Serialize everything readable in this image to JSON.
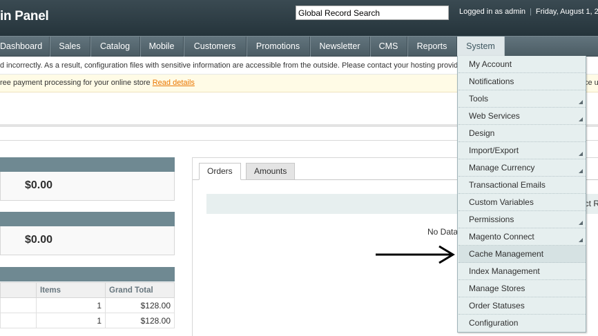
{
  "header": {
    "logo_text": "in Panel",
    "search_value": "Global Record Search",
    "user_text": "Logged in as admin",
    "date_text": "Friday, August 1, 2"
  },
  "nav": {
    "items": [
      {
        "label": "Dashboard"
      },
      {
        "label": "Sales"
      },
      {
        "label": "Catalog"
      },
      {
        "label": "Mobile"
      },
      {
        "label": "Customers"
      },
      {
        "label": "Promotions"
      },
      {
        "label": "Newsletter"
      },
      {
        "label": "CMS"
      },
      {
        "label": "Reports"
      },
      {
        "label": "System"
      }
    ]
  },
  "notices": {
    "warning_text": "d incorrectly. As a result, configuration files with sensitive information are accessible from the outside. Please contact your hosting provid",
    "promo_text": "ree payment processing for your online store ",
    "promo_link": "Read details",
    "promo_tail": "ce u"
  },
  "dashboard": {
    "box1_amount": "$0.00",
    "box2_amount": "$0.00",
    "orders_table": {
      "headers": [
        "",
        "Items",
        "Grand Total"
      ],
      "rows": [
        [
          "",
          "1",
          "$128.00"
        ],
        [
          "",
          "1",
          "$128.00"
        ]
      ]
    },
    "tabs": [
      {
        "label": "Orders"
      },
      {
        "label": "Amounts"
      }
    ],
    "graph_tail_text": "ect R",
    "no_data_text": "No Data"
  },
  "system_menu": {
    "items": [
      {
        "label": "My Account",
        "has_children": false
      },
      {
        "label": "Notifications",
        "has_children": false
      },
      {
        "label": "Tools",
        "has_children": true
      },
      {
        "label": "Web Services",
        "has_children": true
      },
      {
        "label": "Design",
        "has_children": false
      },
      {
        "label": "Import/Export",
        "has_children": true
      },
      {
        "label": "Manage Currency",
        "has_children": true
      },
      {
        "label": "Transactional Emails",
        "has_children": false
      },
      {
        "label": "Custom Variables",
        "has_children": false
      },
      {
        "label": "Permissions",
        "has_children": true
      },
      {
        "label": "Magento Connect",
        "has_children": true
      },
      {
        "label": "Cache Management",
        "has_children": false
      },
      {
        "label": "Index Management",
        "has_children": false
      },
      {
        "label": "Manage Stores",
        "has_children": false
      },
      {
        "label": "Order Statuses",
        "has_children": false
      },
      {
        "label": "Configuration",
        "has_children": false
      }
    ]
  },
  "colors": {
    "header_bg": "#2d3d45",
    "nav_bg": "#55676f",
    "menu_bg": "#e6efef",
    "link": "#ea7601",
    "box_head": "#6f8992"
  }
}
